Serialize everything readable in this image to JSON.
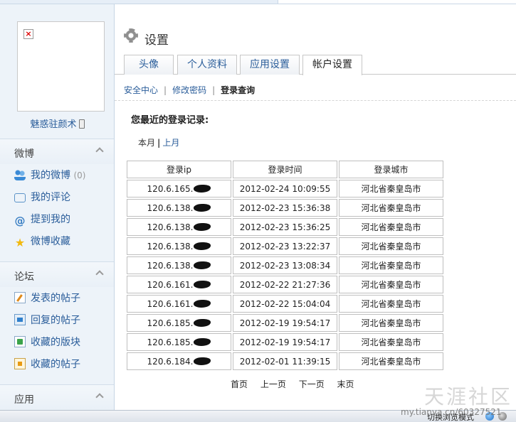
{
  "sidebar": {
    "username": "魅惑驻颜术",
    "sections": [
      {
        "title": "微博",
        "items": [
          {
            "label": "我的微博",
            "count": "(0)",
            "icon": "users-icon"
          },
          {
            "label": "我的评论",
            "icon": "comment-icon"
          },
          {
            "label": "提到我的",
            "icon": "at-icon"
          },
          {
            "label": "微博收藏",
            "icon": "star-icon"
          }
        ]
      },
      {
        "title": "论坛",
        "items": [
          {
            "label": "发表的帖子",
            "icon": "edit-icon"
          },
          {
            "label": "回复的帖子",
            "icon": "reply-icon"
          },
          {
            "label": "收藏的版块",
            "icon": "board-icon"
          },
          {
            "label": "收藏的帖子",
            "icon": "post-icon"
          }
        ]
      },
      {
        "title": "应用"
      }
    ]
  },
  "header": {
    "title": "设置"
  },
  "tabs": [
    {
      "label": "头像"
    },
    {
      "label": "个人资料"
    },
    {
      "label": "应用设置"
    },
    {
      "label": "帐户设置",
      "active": true
    }
  ],
  "subnav": {
    "items": [
      "安全中心",
      "修改密码",
      "登录查询"
    ],
    "separator": "|"
  },
  "records": {
    "title": "您最近的登录记录:",
    "period_current": "本月",
    "period_sep": "|",
    "period_prev": "上月",
    "columns": [
      "登录ip",
      "登录时间",
      "登录城市"
    ],
    "rows": [
      {
        "ip": "120.6.165.",
        "time": "2012-02-24 10:09:55",
        "city": "河北省秦皇岛市"
      },
      {
        "ip": "120.6.138.",
        "time": "2012-02-23 15:36:38",
        "city": "河北省秦皇岛市"
      },
      {
        "ip": "120.6.138.",
        "time": "2012-02-23 15:36:25",
        "city": "河北省秦皇岛市"
      },
      {
        "ip": "120.6.138.",
        "time": "2012-02-23 13:22:37",
        "city": "河北省秦皇岛市"
      },
      {
        "ip": "120.6.138.",
        "time": "2012-02-23 13:08:34",
        "city": "河北省秦皇岛市"
      },
      {
        "ip": "120.6.161.",
        "time": "2012-02-22 21:27:36",
        "city": "河北省秦皇岛市"
      },
      {
        "ip": "120.6.161.",
        "time": "2012-02-22 15:04:04",
        "city": "河北省秦皇岛市"
      },
      {
        "ip": "120.6.185.",
        "time": "2012-02-19 19:54:17",
        "city": "河北省秦皇岛市"
      },
      {
        "ip": "120.6.185.",
        "time": "2012-02-19 19:54:17",
        "city": "河北省秦皇岛市"
      },
      {
        "ip": "120.6.184.",
        "time": "2012-02-01 11:39:15",
        "city": "河北省秦皇岛市"
      }
    ]
  },
  "pager": {
    "first": "首页",
    "prev": "上一页",
    "next": "下一页",
    "last": "末页"
  },
  "statusbar": {
    "mode_text": "切换浏览模式"
  },
  "watermark": {
    "text": "天涯社区",
    "url": "my.tianya.cn/60327521"
  }
}
